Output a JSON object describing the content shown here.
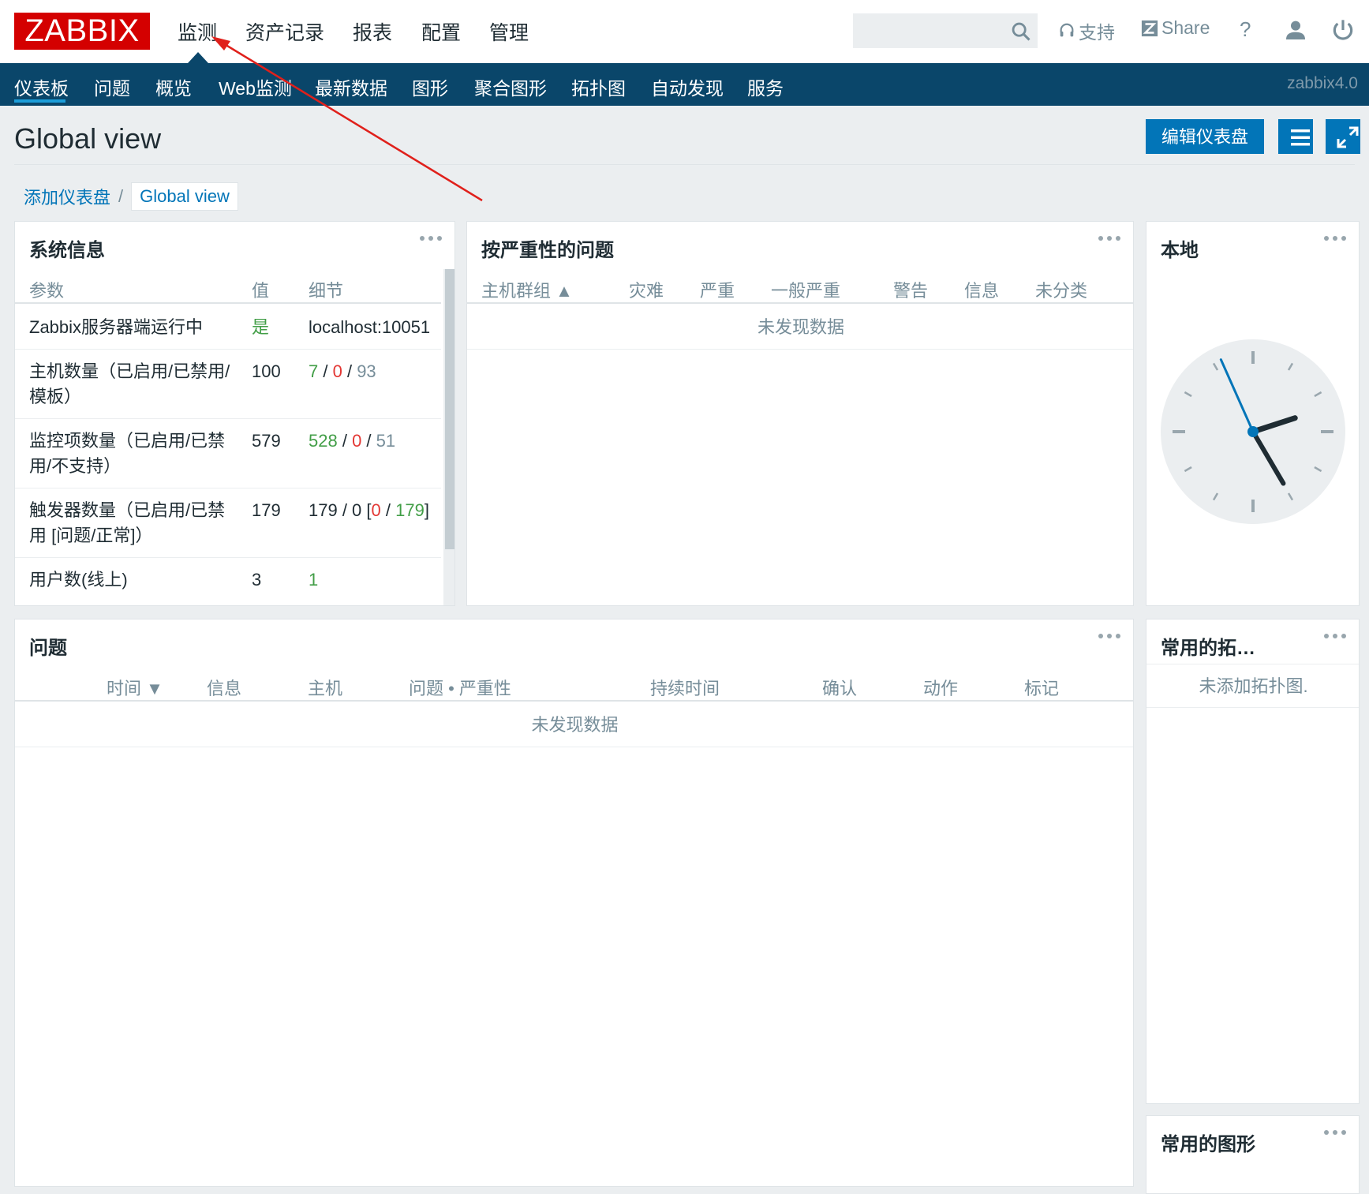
{
  "header": {
    "logo": "ZABBIX",
    "nav": [
      "监测",
      "资产记录",
      "报表",
      "配置",
      "管理"
    ],
    "search_placeholder": "",
    "support_label": "支持",
    "share_label": "Share",
    "help_label": "?"
  },
  "subnav": {
    "items": [
      "仪表板",
      "问题",
      "概览",
      "Web监测",
      "最新数据",
      "图形",
      "聚合图形",
      "拓扑图",
      "自动发现",
      "服务"
    ],
    "active": "仪表板",
    "version": "zabbix4.0"
  },
  "page": {
    "title": "Global view",
    "edit_button": "编辑仪表盘"
  },
  "breadcrumb": {
    "link": "添加仪表盘",
    "separator": "/",
    "current": "Global view"
  },
  "sysinfo": {
    "title": "系统信息",
    "headers": [
      "参数",
      "值",
      "细节"
    ],
    "rows": [
      {
        "param": "Zabbix服务器端运行中",
        "value": "是",
        "detail": "localhost:10051"
      },
      {
        "param": "主机数量（已启用/已禁用/模板）",
        "value": "100",
        "d1": "7",
        "d2": "0",
        "d3": "93"
      },
      {
        "param": "监控项数量（已启用/已禁用/不支持）",
        "value": "579",
        "d1": "528",
        "d2": "0",
        "d3": "51"
      },
      {
        "param": "触发器数量（已启用/已禁用 [问题/正常]）",
        "value": "179",
        "d_pre": "179 / 0 [",
        "d1": "0",
        "d_mid": " / ",
        "d2": "179",
        "d_post": "]"
      },
      {
        "param": "用户数(线上)",
        "value": "3",
        "detail": "1"
      }
    ],
    "slash": " / "
  },
  "severity": {
    "title": "按严重性的问题",
    "headers": [
      "主机群组 ▲",
      "灾难",
      "严重",
      "一般严重",
      "警告",
      "信息",
      "未分类"
    ],
    "no_data": "未发现数据"
  },
  "clock": {
    "title": "本地",
    "hour": 2,
    "minute": 24,
    "second": 56
  },
  "problems": {
    "title": "问题",
    "headers": [
      "时间 ▼",
      "信息",
      "主机",
      "问题 • 严重性",
      "持续时间",
      "确认",
      "动作",
      "标记"
    ],
    "no_data": "未发现数据"
  },
  "fav_maps": {
    "title": "常用的拓…",
    "empty": "未添加拓扑图."
  },
  "fav_graphs": {
    "title": "常用的图形"
  },
  "colors": {
    "brand": "#d40000",
    "subnav": "#0a466a",
    "primary": "#0275b8",
    "ok": "#429e47",
    "problem": "#e33734",
    "annotation": "#e0201b"
  }
}
